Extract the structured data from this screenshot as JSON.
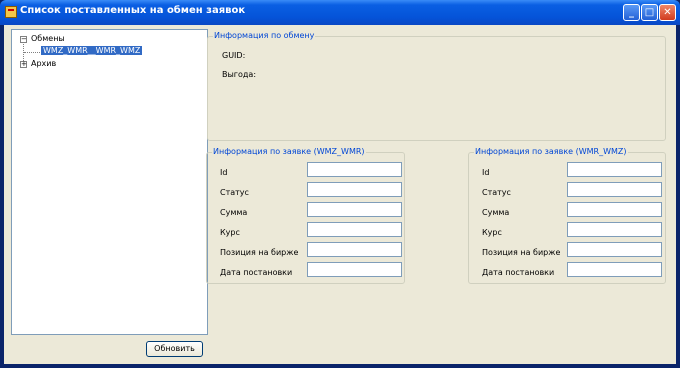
{
  "window": {
    "title": "Список поставленных на обмен заявок",
    "minimize_glyph": "_",
    "maximize_glyph": "□",
    "close_glyph": "✕"
  },
  "tree": {
    "root": {
      "label": "Обмены",
      "expander": "−"
    },
    "child": {
      "label": "WMZ_WMR__WMR_WMZ"
    },
    "archive": {
      "label": "Архив",
      "expander": "+"
    }
  },
  "refresh_button": "Обновить",
  "exchange_info": {
    "title": "Информация по обмену",
    "guid_label": "GUID:",
    "benefit_label": "Выгода:"
  },
  "order_left": {
    "title": "Информация по заявке (WMZ_WMR)",
    "labels": [
      "Id",
      "Статус",
      "Сумма",
      "Курс",
      "Позиция на бирже",
      "Дата постановки"
    ],
    "values": [
      "",
      "",
      "",
      "",
      "",
      ""
    ]
  },
  "order_right": {
    "title": "Информация по заявке (WMR_WMZ)",
    "labels": [
      "Id",
      "Статус",
      "Сумма",
      "Курс",
      "Позиция на бирже",
      "Дата постановки"
    ],
    "values": [
      "",
      "",
      "",
      "",
      "",
      ""
    ]
  }
}
